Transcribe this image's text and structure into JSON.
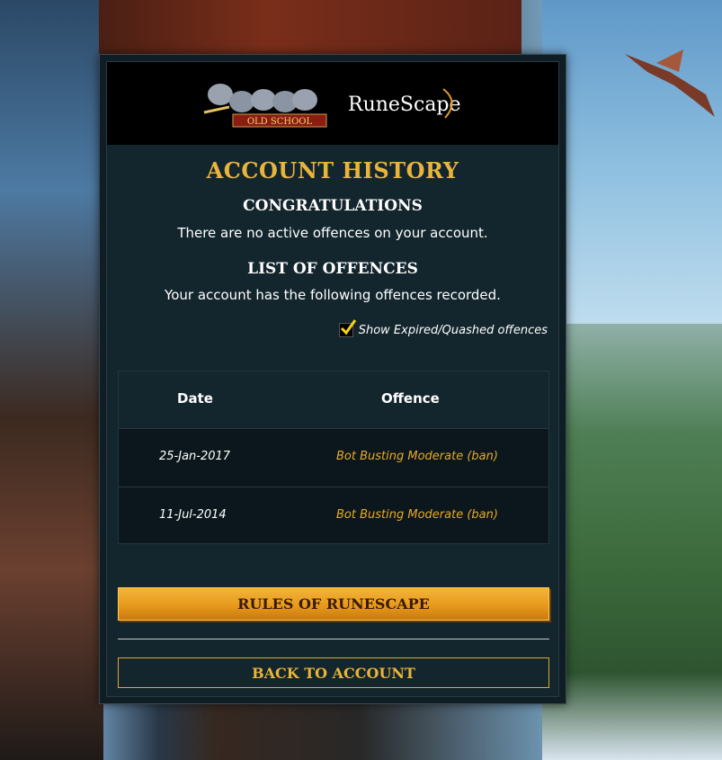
{
  "header": {
    "logo_osrs_text": "RuneScape Old School",
    "logo_rs_text": "RuneScape"
  },
  "page": {
    "title": "ACCOUNT HISTORY",
    "congrats_heading": "CONGRATULATIONS",
    "congrats_text": "There are no active offences on your account.",
    "list_heading": "LIST OF OFFENCES",
    "list_text": "Your account has the following offences recorded."
  },
  "filter": {
    "show_expired_label": "Show Expired/Quashed offences",
    "checked": true
  },
  "table": {
    "columns": [
      "Date",
      "Offence"
    ],
    "rows": [
      {
        "date": "25-Jan-2017",
        "offence": "Bot Busting Moderate (ban)"
      },
      {
        "date": "11-Jul-2014",
        "offence": "Bot Busting Moderate (ban)"
      }
    ]
  },
  "actions": {
    "rules_label": "RULES OF RUNESCAPE",
    "back_label": "BACK TO ACCOUNT"
  },
  "colors": {
    "accent_gold": "#e8b53a",
    "offence_text": "#e8a92a",
    "panel_bg": "#13252d"
  }
}
